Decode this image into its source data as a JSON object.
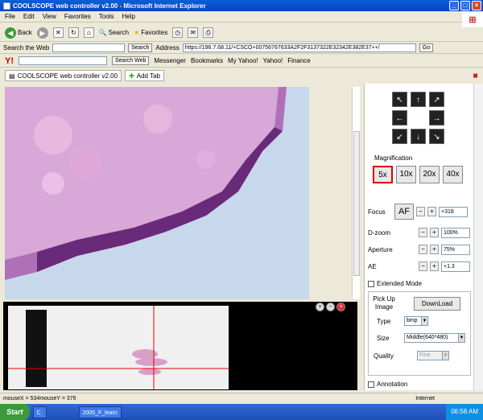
{
  "window": {
    "title": "COOLSCOPE web controller v2.00 - Microsoft Internet Explorer"
  },
  "menu": [
    "File",
    "Edit",
    "View",
    "Favorites",
    "Tools",
    "Help"
  ],
  "toolbar": {
    "back": "Back",
    "search": "Search",
    "favorites": "Favorites"
  },
  "searchbar": {
    "label": "Search the Web",
    "search_btn": "Search",
    "address_label": "Address",
    "url": "https://196.7.68.11/+CSCO+00756767633A2F2F3137322E32342E382E37++/",
    "go": "Go"
  },
  "yahoo": {
    "search_web": "Search Web",
    "messenger": "Messenger",
    "bookmarks": "Bookmarks",
    "my_yahoo": "My Yahoo!",
    "yahoo": "Yahoo!",
    "finance": "Finance"
  },
  "tabs": {
    "current": "COOLSCOPE web controller v2.00",
    "add": "Add Tab"
  },
  "panel": {
    "magnification_label": "Magnification",
    "mag_options": [
      "5x",
      "10x",
      "20x",
      "40x"
    ],
    "focus": {
      "label": "Focus",
      "af": "AF",
      "value": "+318"
    },
    "dzoom": {
      "label": "D-zoom",
      "value": "100%"
    },
    "aperture": {
      "label": "Aperture",
      "value": "75%"
    },
    "ae": {
      "label": "AE",
      "value": "+1.3"
    },
    "extended_mode": "Extended Mode",
    "pickup_label": "Pick Up Image",
    "download": "DownLoad",
    "type_label": "Type",
    "type_value": "bmp",
    "size_label": "Size",
    "size_value": "Middle(640*480)",
    "quality_label": "Quality",
    "quality_value": "Fine",
    "annotation": "Annotation"
  },
  "statusbar": {
    "mouse": "mouseX = 534mouseY = 376",
    "zone": "Internet"
  },
  "taskbar": {
    "start": "Start",
    "task1": "C.",
    "task2": "2005_F_learn",
    "clock": "06:58 AM"
  }
}
